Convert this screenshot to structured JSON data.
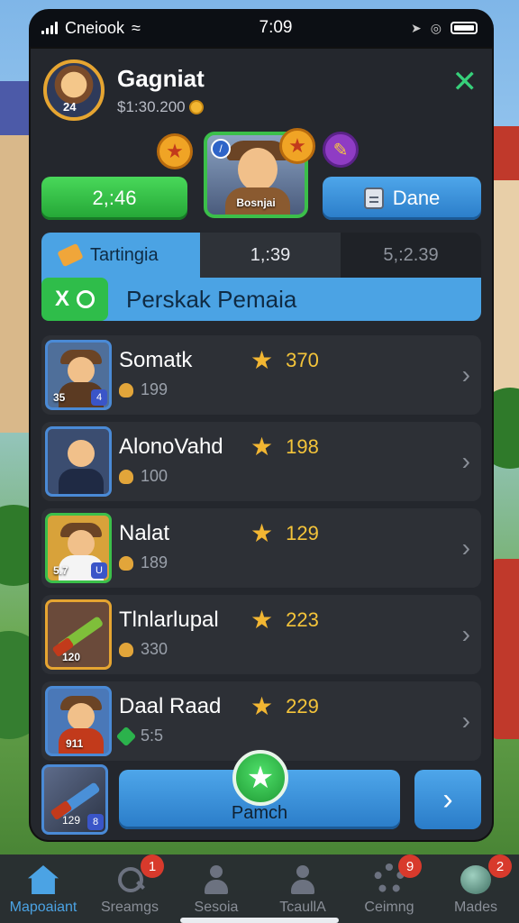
{
  "status_bar": {
    "carrier": "Cneiook",
    "time": "7:09"
  },
  "profile": {
    "name": "Gagniat",
    "coins": "$1:30.200",
    "avatar_level": "24"
  },
  "hero_card": {
    "label": "Bosnjai"
  },
  "actions": {
    "left_value": "2,:46",
    "done_label": "Dane"
  },
  "tabs": [
    {
      "label": "Tartingia"
    },
    {
      "label": "1,:39"
    },
    {
      "label": "5,:2.39"
    }
  ],
  "banner": {
    "toggle_label": "X",
    "text": "Perskak Pemaia"
  },
  "rows": [
    {
      "name": "Somatk",
      "sub": "199",
      "score": "370",
      "thumb_num": "35",
      "mini": "4"
    },
    {
      "name": "AlonoVahd",
      "sub": "100",
      "score": "198",
      "thumb_num": "",
      "mini": ""
    },
    {
      "name": "Nalat",
      "sub": "189",
      "score": "129",
      "thumb_num": "5.7",
      "mini": "U"
    },
    {
      "name": "Tlnlarlupal",
      "sub": "330",
      "score": "223",
      "thumb_num": "120",
      "mini": ""
    },
    {
      "name": "Daal Raad",
      "sub": "5:5",
      "score": "229",
      "thumb_num": "911",
      "mini": ""
    }
  ],
  "bottom_action": {
    "thumb_num": "129",
    "mini": "8",
    "button_label": "Pamch"
  },
  "nav": [
    {
      "label": "Mapoaiant",
      "badge": ""
    },
    {
      "label": "Sreamgs",
      "badge": "1"
    },
    {
      "label": "Sesoia",
      "badge": ""
    },
    {
      "label": "TcaullA",
      "badge": ""
    },
    {
      "label": "Ceimng",
      "badge": "9"
    },
    {
      "label": "Mades",
      "badge": "2"
    }
  ],
  "colors": {
    "accent_blue": "#4ba3e4",
    "accent_green": "#2fbd4a",
    "score_gold": "#f4c43a",
    "badge_red": "#d83a2c"
  }
}
